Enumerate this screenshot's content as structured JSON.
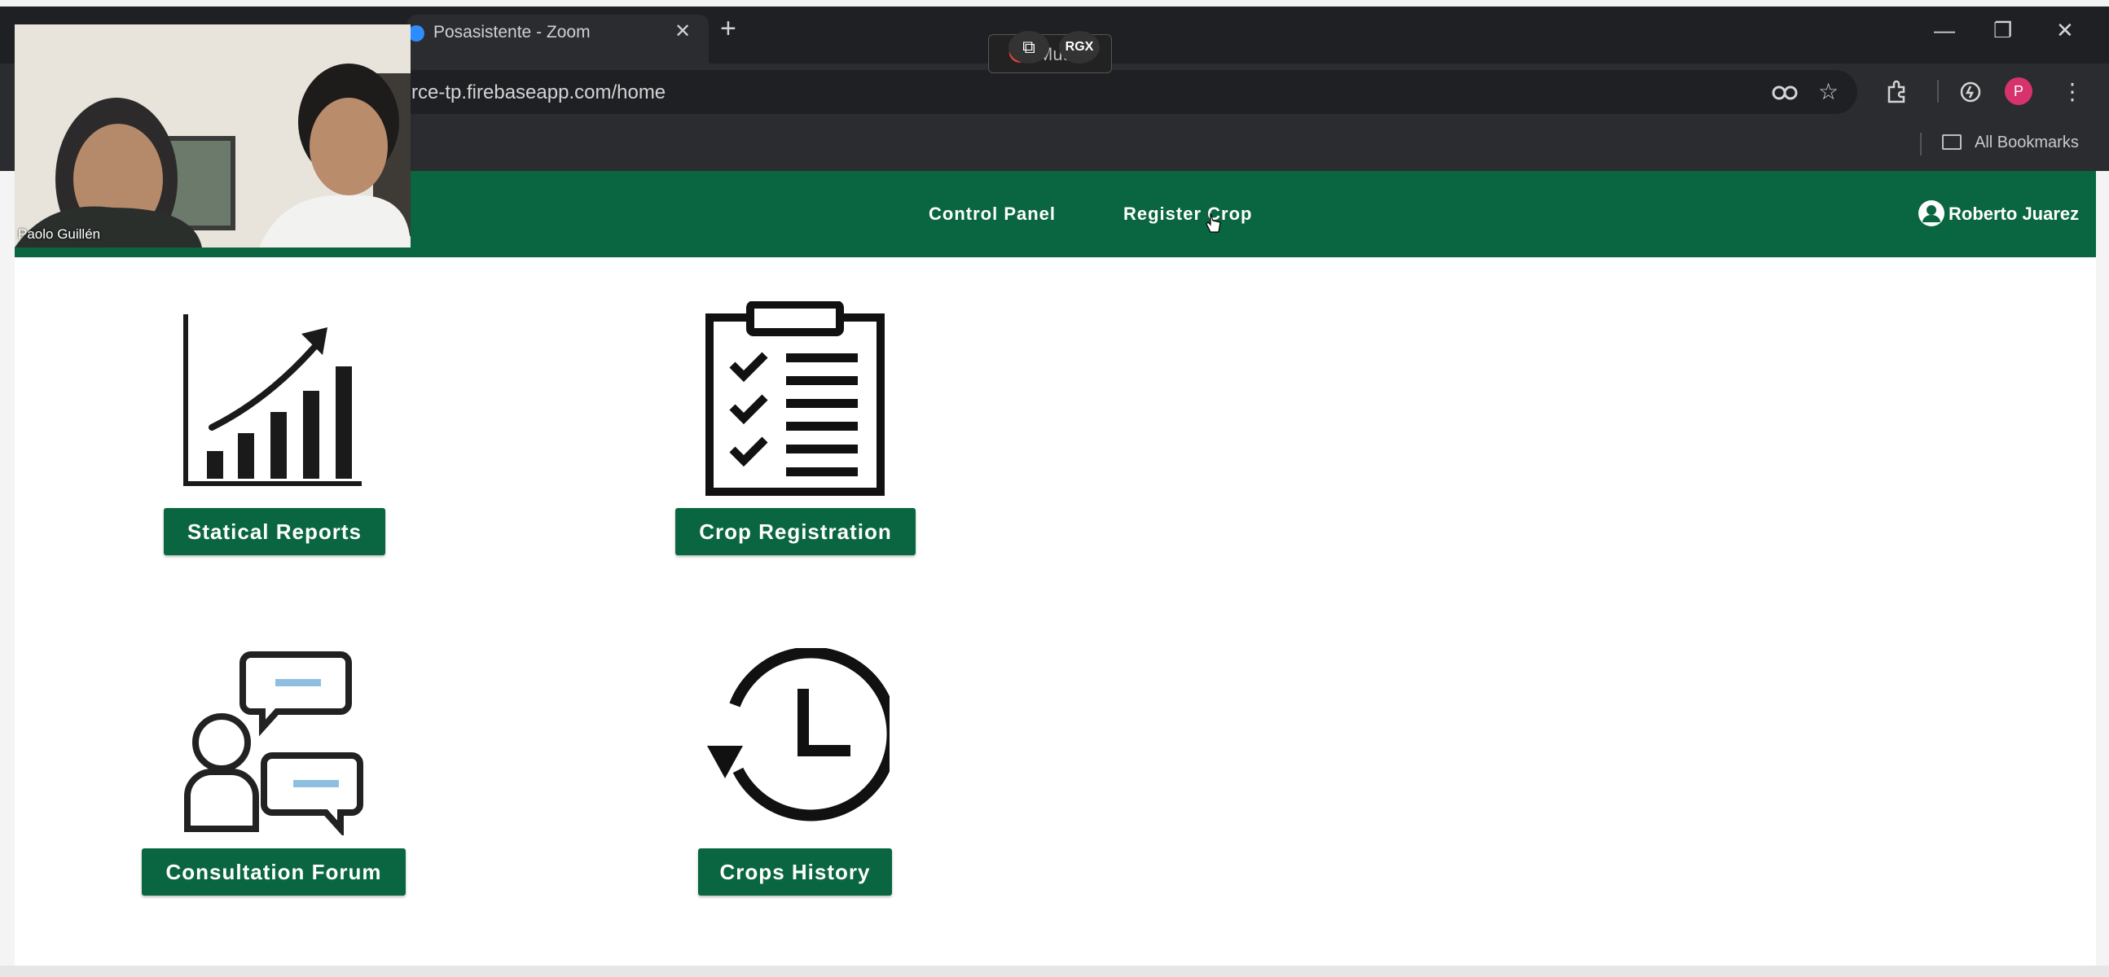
{
  "browser": {
    "tab_title": "Posasistente - Zoom",
    "url": "rce-tp.firebaseapp.com/home",
    "bookmarks_label": "All Bookmarks",
    "profile_initial": "P"
  },
  "zoom": {
    "muted_label": "Muted",
    "rgx_badge": "RGX",
    "participant_name": "Paolo Guillén"
  },
  "navbar": {
    "links": [
      "Control Panel",
      "Register Crop"
    ],
    "user_name": "Roberto Juarez",
    "brand_color": "#0a6640"
  },
  "cards": [
    {
      "label": "Statical Reports",
      "icon": "bar-chart-growth-icon"
    },
    {
      "label": "Crop Registration",
      "icon": "clipboard-checklist-icon"
    },
    {
      "label": "Consultation Forum",
      "icon": "forum-chat-icon"
    },
    {
      "label": "Crops History",
      "icon": "history-clock-icon"
    }
  ]
}
